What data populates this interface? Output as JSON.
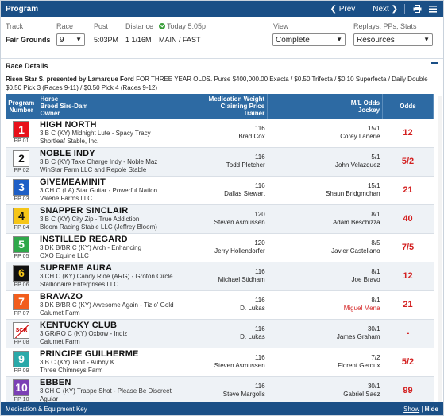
{
  "header": {
    "title": "Program",
    "prev_label": "Prev",
    "next_label": "Next"
  },
  "filters": {
    "track_label": "Track",
    "track_value": "Fair Grounds",
    "race_label": "Race",
    "race_value": "9",
    "post_label": "Post",
    "post_value": "5:03PM",
    "distance_label": "Distance",
    "distance_value": "1 1/16M",
    "today_label": "Today 5:05p",
    "surface_value": "MAIN / FAST",
    "view_label": "View",
    "view_value": "Complete",
    "replays_label": "Replays, PPs, Stats",
    "replays_value": "Resources"
  },
  "race_details": {
    "heading": "Race Details",
    "race_name": "Risen Star S. presented by Lamarque Ford",
    "description": "FOR THREE YEAR OLDS. Purse $400,000.00 Exacta / $0.50 Trifecta / $0.10 Superfecta / Daily Double $0.50 Pick 3 (Races 9-11) / $0.50 Pick 4 (Races 9-12)"
  },
  "table": {
    "col_program": "Program Number",
    "col_horse": "Horse\nBreed Sire-Dam\nOwner",
    "col_med": "Medication Weight\nClaiming Price\nTrainer",
    "col_ml": "M/L Odds\nJockey",
    "col_odds": "Odds",
    "rows": [
      {
        "num": "1",
        "pp": "PP 01",
        "bg": "#e8101a",
        "fg": "#ffffff",
        "name": "HIGH NORTH",
        "breed": "3 B C (KY) Midnight Lute - Spacy Tracy",
        "owner": "Shortleaf Stable, Inc.",
        "weight": "116",
        "trainer": "Brad Cox",
        "ml": "15/1",
        "jockey": "Corey Lanerie",
        "odds": "12",
        "scratched": false
      },
      {
        "num": "2",
        "pp": "PP 02",
        "bg": "#ffffff",
        "fg": "#111111",
        "name": "NOBLE INDY",
        "breed": "3 B C (KY) Take Charge Indy - Noble Maz",
        "owner": "WinStar Farm LLC and Repole Stable",
        "weight": "116",
        "trainer": "Todd Pletcher",
        "ml": "5/1",
        "jockey": "John Velazquez",
        "odds": "5/2",
        "scratched": false
      },
      {
        "num": "3",
        "pp": "PP 03",
        "bg": "#1e5fc6",
        "fg": "#ffffff",
        "name": "GIVEMEAMINIT",
        "breed": "3 CH C (LA) Star Guitar - Powerful Nation",
        "owner": "Valene Farms LLC",
        "weight": "116",
        "trainer": "Dallas Stewart",
        "ml": "15/1",
        "jockey": "Shaun Bridgmohan",
        "odds": "21",
        "scratched": false
      },
      {
        "num": "4",
        "pp": "PP 04",
        "bg": "#f5c518",
        "fg": "#111111",
        "name": "SNAPPER SINCLAIR",
        "breed": "3 B C (KY) City Zip - True Addiction",
        "owner": "Bloom Racing Stable LLC (Jeffrey Bloom)",
        "weight": "120",
        "trainer": "Steven Asmussen",
        "ml": "8/1",
        "jockey": "Adam Beschizza",
        "odds": "40",
        "scratched": false
      },
      {
        "num": "5",
        "pp": "PP 05",
        "bg": "#2fa84a",
        "fg": "#ffffff",
        "name": "INSTILLED REGARD",
        "breed": "3 DK B/BR C (KY) Arch - Enhancing",
        "owner": "OXO Equine LLC",
        "weight": "120",
        "trainer": "Jerry Hollendorfer",
        "ml": "8/5",
        "jockey": "Javier Castellano",
        "odds": "7/5",
        "scratched": false
      },
      {
        "num": "6",
        "pp": "PP 06",
        "bg": "#111111",
        "fg": "#f5c518",
        "name": "SUPREME AURA",
        "breed": "3 CH C (KY) Candy Ride (ARG) - Groton Circle",
        "owner": "Stallionaire Enterprises LLC",
        "weight": "116",
        "trainer": "Michael Stidham",
        "ml": "8/1",
        "jockey": "Joe Bravo",
        "odds": "12",
        "scratched": false
      },
      {
        "num": "7",
        "pp": "PP 07",
        "bg": "#f25d1c",
        "fg": "#ffffff",
        "name": "BRAVAZO",
        "breed": "3 DK B/BR C (KY) Awesome Again - Tiz o' Gold",
        "owner": "Calumet Farm",
        "weight": "116",
        "trainer": "D. Lukas",
        "ml": "8/1",
        "jockey": "Miguel Mena",
        "odds": "21",
        "scratched": false,
        "jockey_red": true
      },
      {
        "num": "SCR",
        "pp": "PP 08",
        "bg": "#ffffff",
        "fg": "#cc0000",
        "name": "KENTUCKY CLUB",
        "breed": "3 GR/RO C (KY) Oxbow - Indiz",
        "owner": "Calumet Farm",
        "weight": "116",
        "trainer": "D. Lukas",
        "ml": "30/1",
        "jockey": "James Graham",
        "odds": "-",
        "scratched": true
      },
      {
        "num": "9",
        "pp": "PP 09",
        "bg": "#2aa9a9",
        "fg": "#ffffff",
        "name": "PRINCIPE GUILHERME",
        "breed": "3 B C (KY) Tapit - Aubby K",
        "owner": "Three Chimneys Farm",
        "weight": "116",
        "trainer": "Steven Asmussen",
        "ml": "7/2",
        "jockey": "Florent Geroux",
        "odds": "5/2",
        "scratched": false
      },
      {
        "num": "10",
        "pp": "PP 10",
        "bg": "#7b3fb5",
        "fg": "#ffffff",
        "name": "EBBEN",
        "breed": "3 CH G (KY) Trappe Shot - Please Be Discreet",
        "owner": "Aguiar",
        "weight": "116",
        "trainer": "Steve Margolis",
        "ml": "30/1",
        "jockey": "Gabriel Saez",
        "odds": "99",
        "scratched": false
      }
    ]
  },
  "footer": {
    "label": "Medication & Equipment Key",
    "show": "Show",
    "hide": "Hide"
  }
}
